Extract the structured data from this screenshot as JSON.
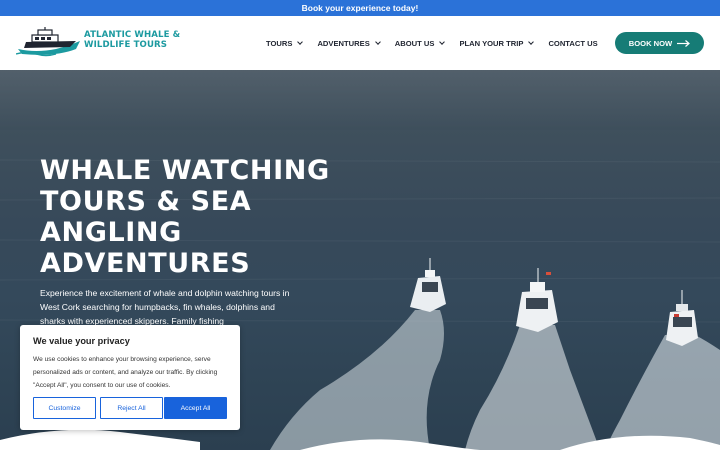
{
  "topbar": {
    "text": "Book your experience today!"
  },
  "logo": {
    "line1": "ATLANTIC WHALE &",
    "line2": "WILDLIFE TOURS"
  },
  "nav": {
    "items": [
      {
        "label": "TOURS",
        "dropdown": true
      },
      {
        "label": "ADVENTURES",
        "dropdown": true
      },
      {
        "label": "ABOUT US",
        "dropdown": true
      },
      {
        "label": "PLAN YOUR TRIP",
        "dropdown": true
      },
      {
        "label": "CONTACT US",
        "dropdown": false
      }
    ],
    "cta": "BOOK NOW"
  },
  "hero": {
    "title_lines": [
      "WHALE WATCHING",
      "TOURS & SEA",
      "ANGLING",
      "ADVENTURES"
    ],
    "description": "Experience the excitement of whale and dolphin watching tours in West Cork searching for humpbacks, fin whales, dolphins and sharks with experienced skippers. Family fishing"
  },
  "cookie": {
    "title": "We value your privacy",
    "text": "We use cookies to enhance your browsing experience, serve personalized ads or content, and analyze our traffic. By clicking \"Accept All\", you consent to our use of cookies.",
    "customize": "Customize",
    "reject": "Reject All",
    "accept": "Accept All"
  },
  "colors": {
    "topbar": "#2b72d8",
    "brand_teal": "#167c76",
    "logo_text": "#1c9aa0",
    "cookie_blue": "#1863dc"
  }
}
